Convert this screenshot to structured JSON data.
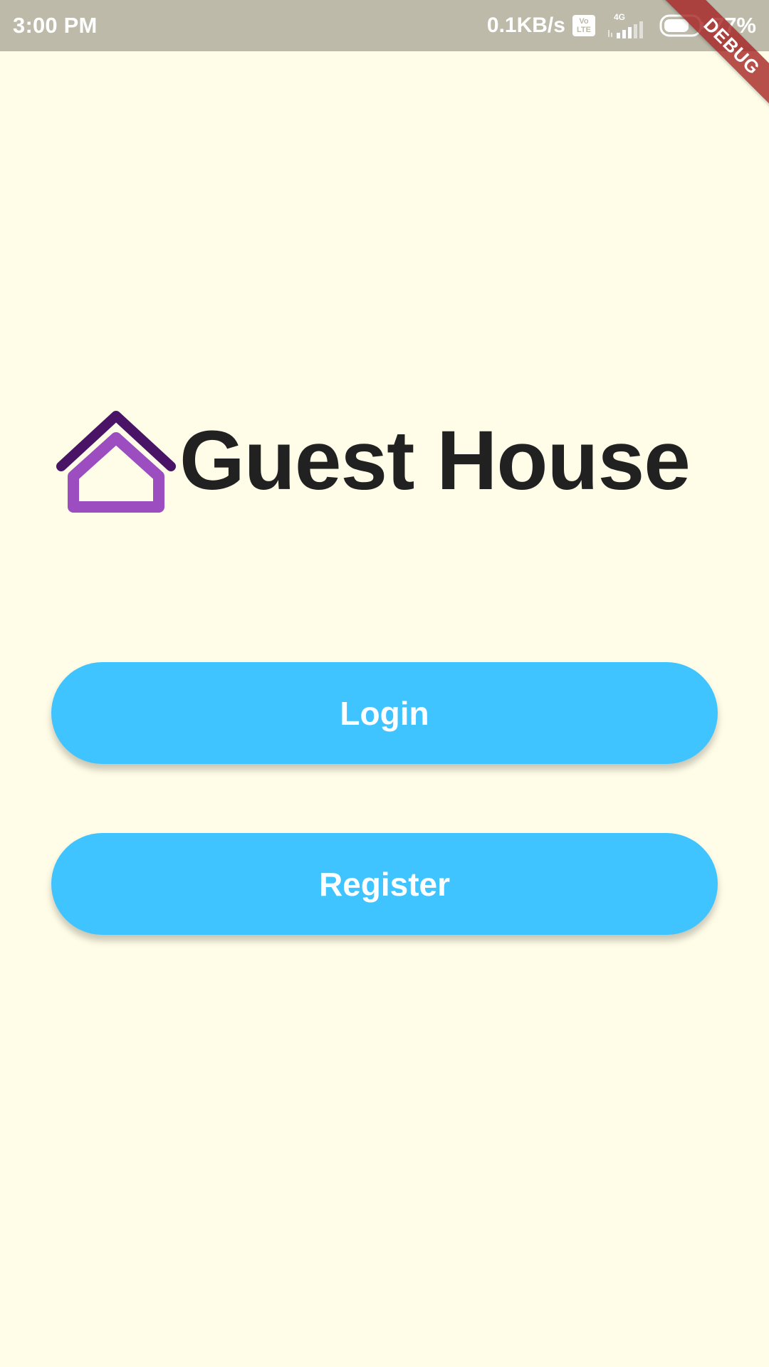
{
  "status_bar": {
    "time": "3:00 PM",
    "net_speed": "0.1KB/s",
    "volte_top": "Vo",
    "volte_bottom": "LTE",
    "network_type": "4G",
    "battery_percent": "77%",
    "battery_level": 0.77,
    "background_color": "#BDBAA9"
  },
  "debug_banner": {
    "label": "DEBUG"
  },
  "brand": {
    "icon": "house-icon",
    "title": "Guest House",
    "icon_colors": {
      "roof": "#4A1466",
      "body": "#9C4DC0"
    }
  },
  "actions": {
    "login_label": "Login",
    "register_label": "Register",
    "button_color": "#40C4FF"
  },
  "background_color": "#FFFDE7"
}
